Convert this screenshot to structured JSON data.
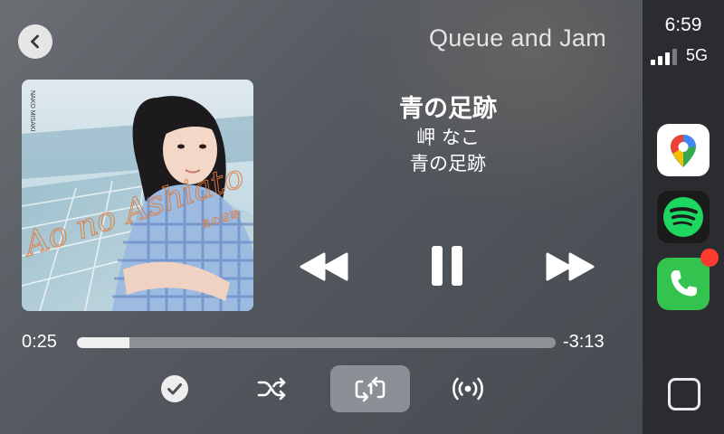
{
  "app": {
    "title": "Queue and Jam"
  },
  "track": {
    "title": "青の足跡",
    "artist": "岬 なこ",
    "album": "青の足跡",
    "art_text_artist": "NAKO MISAKI",
    "art_text_script": "Ao no Ashiato",
    "art_text_jp": "青の足跡"
  },
  "playback": {
    "elapsed": "0:25",
    "remaining": "-3:13",
    "progress_fraction": 0.11,
    "state": "playing"
  },
  "controls": {
    "back_icon": "chevron-left-icon",
    "rewind_icon": "rewind-icon",
    "pause_icon": "pause-icon",
    "forward_icon": "fast-forward-icon",
    "favorite_icon": "checkmark-circle-icon",
    "shuffle_icon": "shuffle-icon",
    "repeat_icon": "repeat-one-icon",
    "broadcast_icon": "broadcast-icon"
  },
  "status": {
    "time": "6:59",
    "network": "5G",
    "signal_bars": 3
  },
  "dock": {
    "apps": [
      {
        "name": "Google Maps",
        "icon": "google-maps-icon"
      },
      {
        "name": "Spotify",
        "icon": "spotify-icon",
        "color": "#1ed760"
      },
      {
        "name": "Phone",
        "icon": "phone-icon",
        "color": "#34c759",
        "badge": true
      }
    ]
  },
  "colors": {
    "progress_fill": "#f0f0f0",
    "progress_track": "#8d9196",
    "badge": "#ff3b30"
  }
}
